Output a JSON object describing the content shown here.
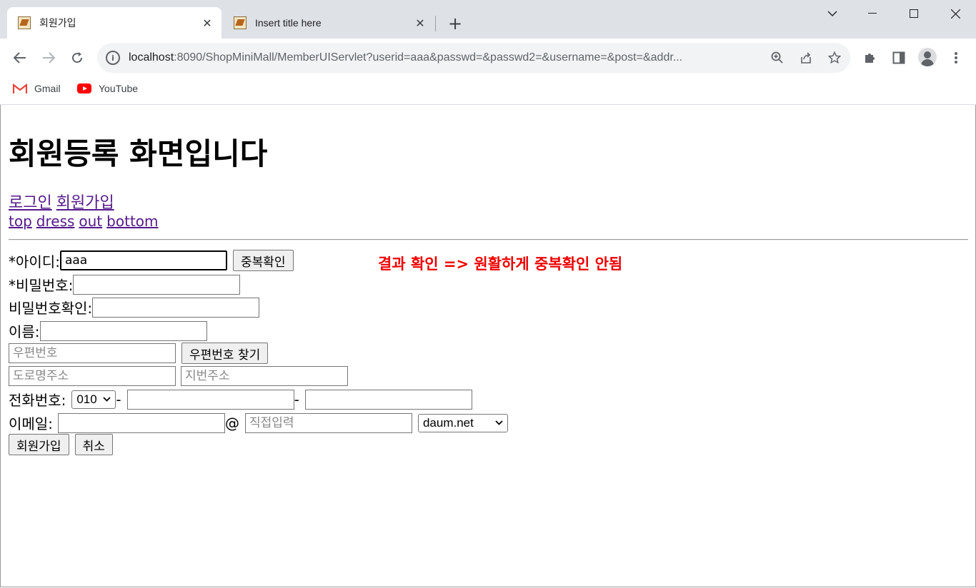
{
  "browser": {
    "tabs": [
      {
        "title": "회원가입",
        "active": true
      },
      {
        "title": "Insert title here",
        "active": false
      }
    ],
    "url_host": "localhost",
    "url_rest": ":8090/ShopMiniMall/MemberUIServlet?userid=aaa&passwd=&passwd2=&username=&post=&addr...",
    "bookmarks": [
      {
        "label": "Gmail",
        "icon": "gmail-icon"
      },
      {
        "label": "YouTube",
        "icon": "youtube-icon"
      }
    ]
  },
  "page": {
    "title": "회원등록 화면입니다",
    "links_primary": [
      "로그인",
      "회원가입"
    ],
    "links_category": [
      "top",
      "dress",
      "out",
      "bottom"
    ],
    "form": {
      "userid_label": "*아이디:",
      "userid_value": "aaa",
      "dup_check_button": "중복확인",
      "passwd_label": "*비밀번호:",
      "passwd2_label": "비밀번호확인:",
      "username_label": "이름:",
      "post_placeholder": "우편번호",
      "post_button": "우편번호 찾기",
      "addr1_placeholder": "도로명주소",
      "addr2_placeholder": "지번주소",
      "phone_label": "전화번호:",
      "phone_prefix": "010",
      "dash": "-",
      "email_label": "이메일:",
      "at": "@",
      "email_domain_placeholder": "직접입력",
      "email_domain_select": "daum.net",
      "submit_button": "회원가입",
      "cancel_button": "취소"
    },
    "annotation": "결과 확인 => 원활하게 중복확인 안됨"
  },
  "colors": {
    "annotation": "#ee0000",
    "link_visited": "#551a8b",
    "tabstrip_bg": "#dee1e6"
  }
}
